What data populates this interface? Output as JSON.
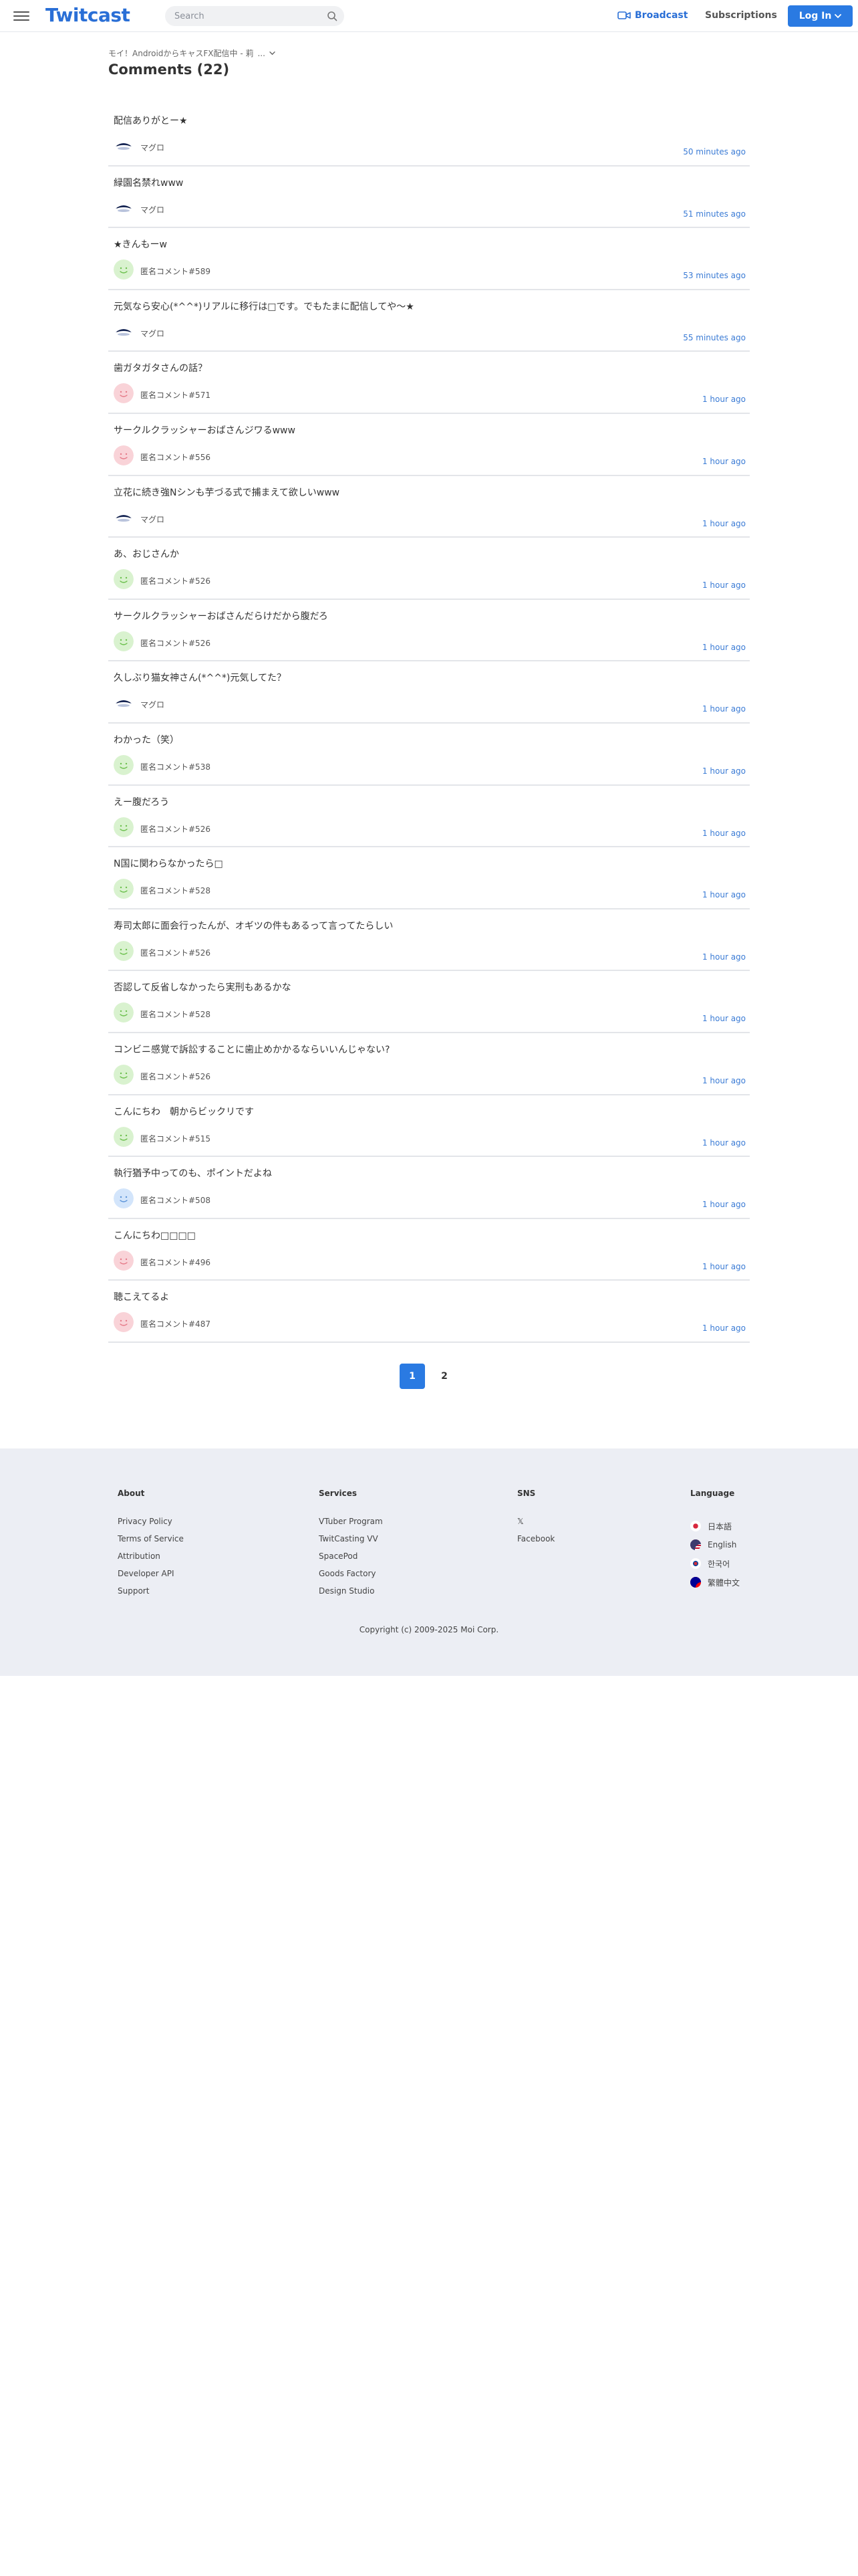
{
  "header": {
    "logo": "Twitcast",
    "search_placeholder": "Search",
    "broadcast_label": "Broadcast",
    "subscriptions_label": "Subscriptions",
    "login_label": "Log In"
  },
  "breadcrumb": {
    "text": "モイ！AndroidからキャスFX配信中 - 莉",
    "more": "..."
  },
  "page_title": "Comments (22)",
  "comments": [
    {
      "text": "配信ありがとー★",
      "name": "マグロ",
      "time": "50 minutes ago",
      "avatar": "fish"
    },
    {
      "text": "緑園名禁れwww",
      "name": "マグロ",
      "time": "51 minutes ago",
      "avatar": "fish"
    },
    {
      "text": "★きんもーw",
      "name": "匿名コメント#589",
      "time": "53 minutes ago",
      "avatar": "green"
    },
    {
      "text": "元気なら安心(*^^*)リアルに移行は□です。でもたまに配信してや〜★",
      "name": "マグロ",
      "time": "55 minutes ago",
      "avatar": "fish"
    },
    {
      "text": "歯ガタガタさんの話？",
      "name": "匿名コメント#571",
      "time": "1 hour ago",
      "avatar": "pink"
    },
    {
      "text": "サークルクラッシャーおばさんジワるwww",
      "name": "匿名コメント#556",
      "time": "1 hour ago",
      "avatar": "pink"
    },
    {
      "text": "立花に続き強Nシンも芋づる式で捕まえて欲しいwww",
      "name": "マグロ",
      "time": "1 hour ago",
      "avatar": "fish"
    },
    {
      "text": "あ、おじさんか",
      "name": "匿名コメント#526",
      "time": "1 hour ago",
      "avatar": "green"
    },
    {
      "text": "サークルクラッシャーおばさんだらけだから腹だろ",
      "name": "匿名コメント#526",
      "time": "1 hour ago",
      "avatar": "green"
    },
    {
      "text": "久しぶり猫女神さん(*^^*)元気してた？",
      "name": "マグロ",
      "time": "1 hour ago",
      "avatar": "fish"
    },
    {
      "text": "わかった（笑）",
      "name": "匿名コメント#538",
      "time": "1 hour ago",
      "avatar": "green"
    },
    {
      "text": "えー腹だろう",
      "name": "匿名コメント#526",
      "time": "1 hour ago",
      "avatar": "green"
    },
    {
      "text": "N国に関わらなかったら□",
      "name": "匿名コメント#528",
      "time": "1 hour ago",
      "avatar": "green"
    },
    {
      "text": "寿司太郎に面会行ったんが、オギツの件もあるって言ってたらしい",
      "name": "匿名コメント#526",
      "time": "1 hour ago",
      "avatar": "green"
    },
    {
      "text": "否認して反省しなかったら実刑もあるかな",
      "name": "匿名コメント#528",
      "time": "1 hour ago",
      "avatar": "green"
    },
    {
      "text": "コンビニ感覚で訴訟することに歯止めかかるならいいんじゃない?",
      "name": "匿名コメント#526",
      "time": "1 hour ago",
      "avatar": "green"
    },
    {
      "text": "こんにちわ　朝からビックリです",
      "name": "匿名コメント#515",
      "time": "1 hour ago",
      "avatar": "green"
    },
    {
      "text": "執行猶予中ってのも、ポイントだよね",
      "name": "匿名コメント#508",
      "time": "1 hour ago",
      "avatar": "blue"
    },
    {
      "text": "こんにちわ□□□□",
      "name": "匿名コメント#496",
      "time": "1 hour ago",
      "avatar": "pink"
    },
    {
      "text": "聴こえてるよ",
      "name": "匿名コメント#487",
      "time": "1 hour ago",
      "avatar": "pink"
    }
  ],
  "pagination": {
    "pages": [
      "1",
      "2"
    ],
    "current": "1"
  },
  "footer": {
    "about": {
      "heading": "About",
      "links": [
        "Privacy Policy",
        "Terms of Service",
        "Attribution",
        "Developer API",
        "Support"
      ]
    },
    "services": {
      "heading": "Services",
      "links": [
        "VTuber Program",
        "TwitCasting VV",
        "SpacePod",
        "Goods Factory",
        "Design Studio"
      ]
    },
    "sns": {
      "heading": "SNS",
      "links": [
        "𝕏",
        "Facebook"
      ]
    },
    "language": {
      "heading": "Language",
      "links": [
        "日本語",
        "English",
        "한국어",
        "繁體中文"
      ]
    },
    "copyright": "Copyright (c) 2009-2025 Moi Corp."
  },
  "colors": {
    "accent": "#2a7ae2",
    "link_blue": "#3a7bd5",
    "footer_bg": "#eceef4",
    "avatar_green": "#d9f2cf",
    "avatar_pink": "#f9d3d8",
    "avatar_blue": "#d3e5fb"
  },
  "icons": {
    "menu": "hamburger-icon",
    "search": "search-icon",
    "broadcast": "camera-icon",
    "login_caret": "chevron-down-icon"
  }
}
